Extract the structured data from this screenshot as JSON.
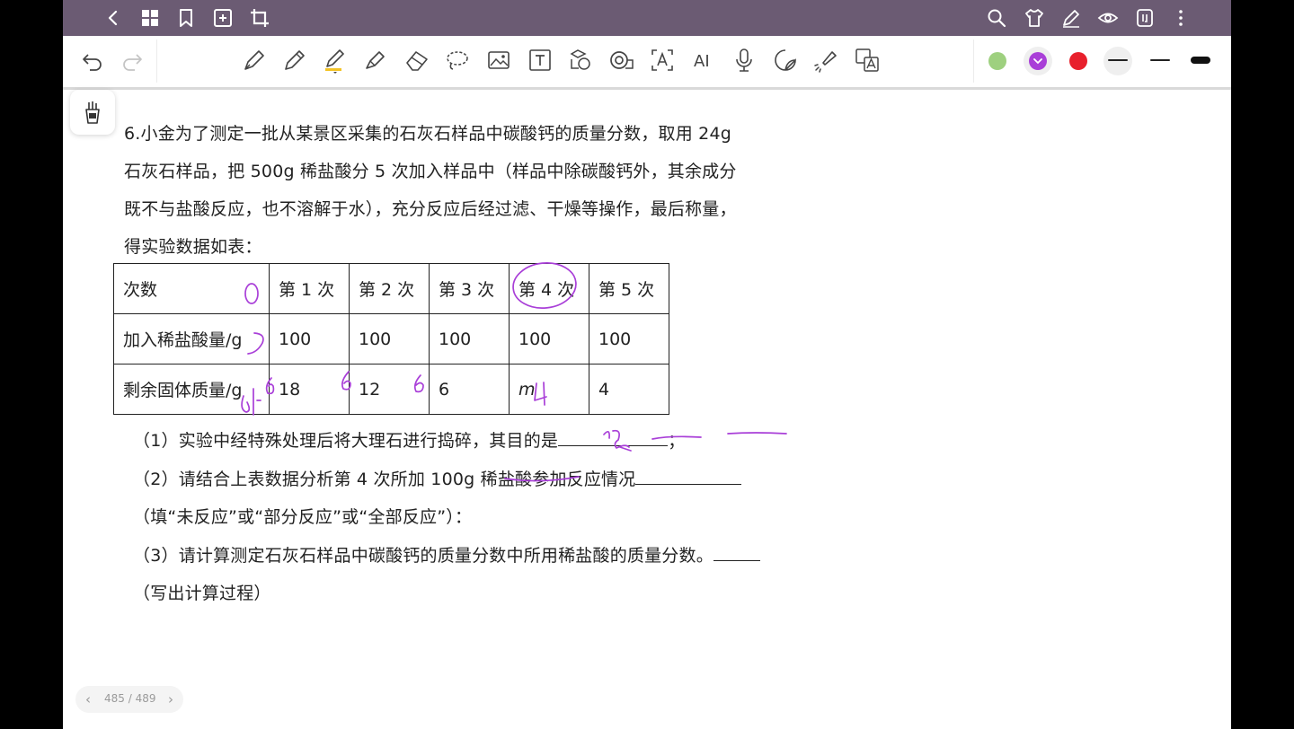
{
  "topbar": {
    "icons": [
      "back-icon",
      "grid-icon",
      "bookmark-icon",
      "add-page-icon",
      "crop-icon",
      "search-icon",
      "shirt-icon",
      "pen-settings-icon",
      "eye-icon",
      "brackets-icon",
      "more-icon"
    ]
  },
  "toolbar": {
    "tools": [
      "undo-icon",
      "redo-icon",
      "fountain-pen-icon",
      "pencil-icon",
      "marker-pen-icon",
      "highlighter-icon",
      "eraser-icon",
      "lasso-icon",
      "image-icon",
      "text-box-icon",
      "shape-icon",
      "tape-icon",
      "text-recognize-icon",
      "ai-icon",
      "microphone-icon",
      "sticker-icon",
      "laser-pointer-icon",
      "translate-icon"
    ],
    "ai_label": "AI",
    "colors": [
      "#9ed07f",
      "#a93fd8",
      "#e8202c"
    ],
    "selected_color": "#a93fd8"
  },
  "document": {
    "q_line1": "6.小金为了测定一批从某景区采集的石灰石样品中碳酸钙的质量分数，取用 24g",
    "q_line2": "石灰石样品，把 500g 稀盐酸分 5 次加入样品中（样品中除碳酸钙外，其余成分",
    "q_line3": "既不与盐酸反应，也不溶解于水），充分反应后经过滤、干燥等操作，最后称量，",
    "q_line4": "得实验数据如表：",
    "table": {
      "header": [
        "次数",
        "第 1 次",
        "第 2 次",
        "第 3 次",
        "第 4 次",
        "第 5 次"
      ],
      "row1": [
        "加入稀盐酸量/g",
        "100",
        "100",
        "100",
        "100",
        "100"
      ],
      "row2": [
        "剩余固体质量/g",
        "18",
        "12",
        "6",
        "m",
        "4"
      ]
    },
    "sub1": "（1）实验中经特殊处理后将大理石进行捣碎，其目的是",
    "sub1_end": "；",
    "sub2": "（2）请结合上表数据分析第 4 次所加 100g 稀盐酸参加反应情况",
    "sub2b": "（填“未反应”或“部分反应”或“全部反应”）：",
    "sub3": "（3）请计算测定石灰石样品中碳酸钙的质量分数中所用稀盐酸的质量分数。",
    "sub3b": "（写出计算过程）"
  },
  "pager": {
    "page_text": "485 / 489",
    "prev": "‹",
    "next": "›"
  }
}
